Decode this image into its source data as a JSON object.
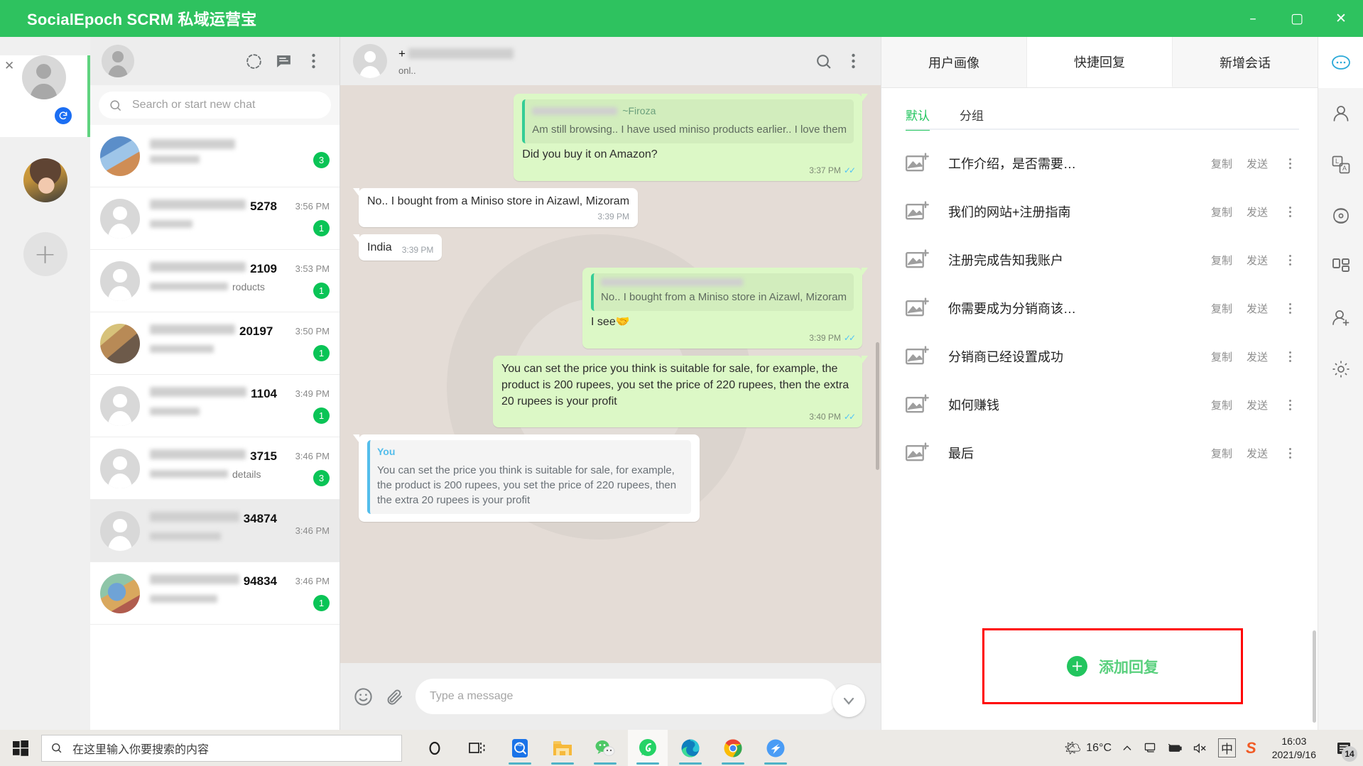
{
  "window": {
    "title": "SocialEpoch SCRM 私域运营宝",
    "minimize": "–",
    "maximize": "▢",
    "close": "✕"
  },
  "account_rail": {
    "close_label": "✕",
    "sync_icon": "sync-icon",
    "add_label": "+"
  },
  "chat_list": {
    "search_placeholder": "Search or start new chat",
    "header_icons": [
      "status-ring-icon",
      "new-chat-icon",
      "menu-icon"
    ],
    "rows": [
      {
        "name_visible": "",
        "preview": "",
        "time": "",
        "badge": "3",
        "selected": false,
        "avatar": "photo1"
      },
      {
        "name_visible": "5278",
        "preview": "",
        "time": "3:56 PM",
        "badge": "1",
        "selected": false,
        "avatar": "default"
      },
      {
        "name_visible": "2109",
        "preview": "roducts",
        "time": "3:53 PM",
        "badge": "1",
        "selected": false,
        "avatar": "default"
      },
      {
        "name_visible": "20197",
        "preview": "",
        "time": "3:50 PM",
        "badge": "1",
        "selected": false,
        "avatar": "photo2"
      },
      {
        "name_visible": "1104",
        "preview": "",
        "time": "3:49 PM",
        "badge": "1",
        "selected": false,
        "avatar": "default"
      },
      {
        "name_visible": "3715",
        "preview": "details",
        "time": "3:46 PM",
        "badge": "3",
        "selected": false,
        "avatar": "default"
      },
      {
        "name_visible": "34874",
        "preview": "",
        "time": "3:46 PM",
        "badge": "",
        "selected": true,
        "avatar": "default"
      },
      {
        "name_visible": "94834",
        "preview": "",
        "time": "3:46 PM",
        "badge": "1",
        "selected": false,
        "avatar": "photo3"
      }
    ]
  },
  "conversation": {
    "contact_prefix": "+",
    "contact_status": "onl..",
    "input_placeholder": "Type a message",
    "messages": [
      {
        "side": "out",
        "quote": {
          "name": "~Firoza",
          "text": "Am still browsing.. I have used miniso products earlier.. I love them"
        },
        "text": "Did you buy it on Amazon?",
        "time": "3:37 PM",
        "ticks": true
      },
      {
        "side": "in",
        "text": "No.. I bought from a Miniso store in Aizawl, Mizoram",
        "time": "3:39 PM",
        "ticks": false
      },
      {
        "side": "in",
        "text": "India",
        "time": "3:39 PM",
        "ticks": false,
        "inline_time": true
      },
      {
        "side": "out",
        "quote": {
          "name": "",
          "text": "No.. I bought from a Miniso store in Aizawl, Mizoram"
        },
        "text": "I see🤝",
        "time": "3:39 PM",
        "ticks": true
      },
      {
        "side": "out",
        "text": "You can set the price you think is suitable for sale, for example, the product is 200 rupees, you set the price of 220 rupees, then the extra 20 rupees is your profit",
        "time": "3:40 PM",
        "ticks": true
      },
      {
        "side": "in",
        "quote_blue": {
          "name": "You",
          "text": "You can set the price you think is suitable for sale, for example, the product is 200 rupees, you set the price of 220 rupees, then the extra 20 rupees is your profit"
        }
      }
    ]
  },
  "scrm": {
    "tabs": [
      {
        "label": "用户画像",
        "active": false
      },
      {
        "label": "快捷回复",
        "active": true
      },
      {
        "label": "新增会话",
        "active": false
      }
    ],
    "subtabs": [
      {
        "label": "默认",
        "active": true
      },
      {
        "label": "分组",
        "active": false
      }
    ],
    "action_copy": "复制",
    "action_send": "发送",
    "quick_replies": [
      {
        "label": "工作介绍，是否需要…"
      },
      {
        "label": "我们的网站+注册指南"
      },
      {
        "label": "注册完成告知我账户"
      },
      {
        "label": "你需要成为分销商该…"
      },
      {
        "label": "分销商已经设置成功"
      },
      {
        "label": "如何赚钱"
      },
      {
        "label": "最后"
      }
    ],
    "add_reply": {
      "plus": "+",
      "label": "添加回复"
    }
  },
  "icon_rail": {
    "items": [
      {
        "name": "chat-bubble-icon",
        "active": true
      },
      {
        "name": "user-icon",
        "active": false
      },
      {
        "name": "translate-icon",
        "active": false
      },
      {
        "name": "atom-icon",
        "active": false
      },
      {
        "name": "apps-grid-icon",
        "active": false
      },
      {
        "name": "add-user-icon",
        "active": false
      },
      {
        "name": "gear-icon",
        "active": false
      }
    ]
  },
  "taskbar": {
    "search_placeholder": "在这里输入你要搜索的内容",
    "weather_temp": "16°C",
    "time": "16:03",
    "date": "2021/9/16",
    "notification_count": "14",
    "ime_label": "中",
    "apps": [
      {
        "name": "cortana-icon",
        "running": false,
        "active": false
      },
      {
        "name": "task-view-icon",
        "running": false,
        "active": false
      },
      {
        "name": "translator-icon",
        "running": true,
        "active": false
      },
      {
        "name": "file-explorer-icon",
        "running": true,
        "active": false
      },
      {
        "name": "wechat-icon",
        "running": true,
        "active": false
      },
      {
        "name": "whatsapp-icon",
        "running": true,
        "active": true
      },
      {
        "name": "edge-icon",
        "running": true,
        "active": false
      },
      {
        "name": "chrome-icon",
        "running": true,
        "active": false
      },
      {
        "name": "dingtalk-icon",
        "running": true,
        "active": false
      }
    ]
  },
  "colors": {
    "brand_green": "#2ec25f",
    "accent_green": "#22c55e",
    "badge_green": "#0ac456",
    "bubble_out": "#dcf8c6",
    "highlight_red": "#ff0000"
  }
}
